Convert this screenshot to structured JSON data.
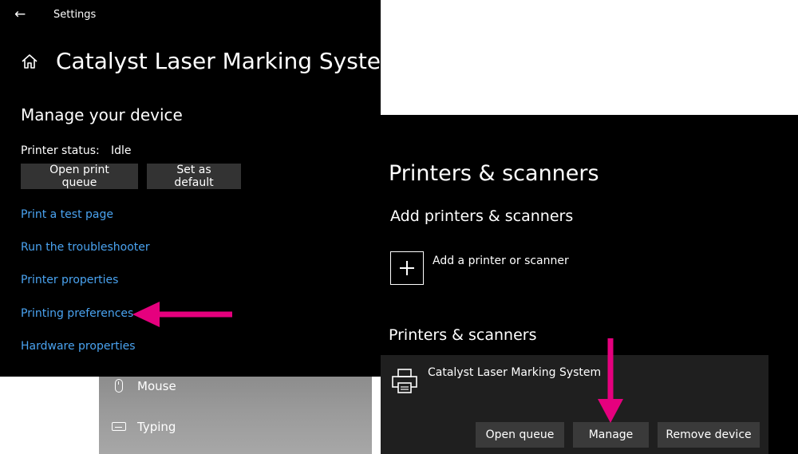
{
  "background_sidebar": {
    "items": [
      {
        "label": "Mouse",
        "icon": "mouse-icon"
      },
      {
        "label": "Typing",
        "icon": "keyboard-icon"
      }
    ]
  },
  "device_window": {
    "title": "Settings",
    "page_title": "Catalyst Laser Marking System",
    "section_heading": "Manage your device",
    "status_label": "Printer status:",
    "status_value": "Idle",
    "buttons": {
      "open_queue": "Open print queue",
      "set_default": "Set as default"
    },
    "links": [
      "Print a test page",
      "Run the troubleshooter",
      "Printer properties",
      "Printing preferences",
      "Hardware properties"
    ]
  },
  "printers_window": {
    "title": "Printers & scanners",
    "add_heading": "Add printers & scanners",
    "add_label": "Add a printer or scanner",
    "list_heading": "Printers & scanners",
    "printer": {
      "name": "Catalyst Laser Marking System",
      "buttons": {
        "open_queue": "Open queue",
        "manage": "Manage",
        "remove": "Remove device"
      }
    }
  },
  "colors": {
    "window_bg": "#000000",
    "link": "#4aa3f0",
    "button_bg": "#333333",
    "annotation_arrow": "#e5007e"
  }
}
